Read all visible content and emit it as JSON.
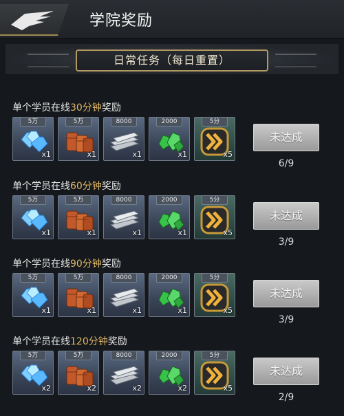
{
  "header": {
    "title": "学院奖励"
  },
  "banner": {
    "label": "日常任务（每日重置）"
  },
  "rows": [
    {
      "title_prefix": "单个学员在线",
      "title_highlight": "30分钟",
      "title_suffix": "奖励",
      "items": [
        {
          "name": "diamond-icon",
          "tag": "5万",
          "qty": "x1"
        },
        {
          "name": "barrel-icon",
          "tag": "5万",
          "qty": "x1"
        },
        {
          "name": "steel-bar-icon",
          "tag": "8000",
          "qty": "x1"
        },
        {
          "name": "green-crystal-icon",
          "tag": "2000",
          "qty": "x1"
        },
        {
          "name": "speedup-icon",
          "tag": "5分",
          "qty": "x5"
        }
      ],
      "status": "未达成",
      "progress": "6/9"
    },
    {
      "title_prefix": "单个学员在线",
      "title_highlight": "60分钟",
      "title_suffix": "奖励",
      "items": [
        {
          "name": "diamond-icon",
          "tag": "5万",
          "qty": "x1"
        },
        {
          "name": "barrel-icon",
          "tag": "5万",
          "qty": "x1"
        },
        {
          "name": "steel-bar-icon",
          "tag": "8000",
          "qty": "x1"
        },
        {
          "name": "green-crystal-icon",
          "tag": "2000",
          "qty": "x1"
        },
        {
          "name": "speedup-icon",
          "tag": "5分",
          "qty": "x5"
        }
      ],
      "status": "未达成",
      "progress": "3/9"
    },
    {
      "title_prefix": "单个学员在线",
      "title_highlight": "90分钟",
      "title_suffix": "奖励",
      "items": [
        {
          "name": "diamond-icon",
          "tag": "5万",
          "qty": "x1"
        },
        {
          "name": "barrel-icon",
          "tag": "5万",
          "qty": "x1"
        },
        {
          "name": "steel-bar-icon",
          "tag": "8000",
          "qty": "x1"
        },
        {
          "name": "green-crystal-icon",
          "tag": "2000",
          "qty": "x1"
        },
        {
          "name": "speedup-icon",
          "tag": "5分",
          "qty": "x5"
        }
      ],
      "status": "未达成",
      "progress": "3/9"
    },
    {
      "title_prefix": "单个学员在线",
      "title_highlight": "120分钟",
      "title_suffix": "奖励",
      "items": [
        {
          "name": "diamond-icon",
          "tag": "5万",
          "qty": "x2"
        },
        {
          "name": "barrel-icon",
          "tag": "5万",
          "qty": "x2"
        },
        {
          "name": "steel-bar-icon",
          "tag": "8000",
          "qty": "x2"
        },
        {
          "name": "green-crystal-icon",
          "tag": "2000",
          "qty": "x2"
        },
        {
          "name": "speedup-icon",
          "tag": "5分",
          "qty": "x5"
        }
      ],
      "status": "未达成",
      "progress": "2/9"
    }
  ],
  "colors": {
    "highlight": "#e2b866",
    "frame_gold": "#b39a63",
    "disabled_button": "#b0b0b0"
  }
}
